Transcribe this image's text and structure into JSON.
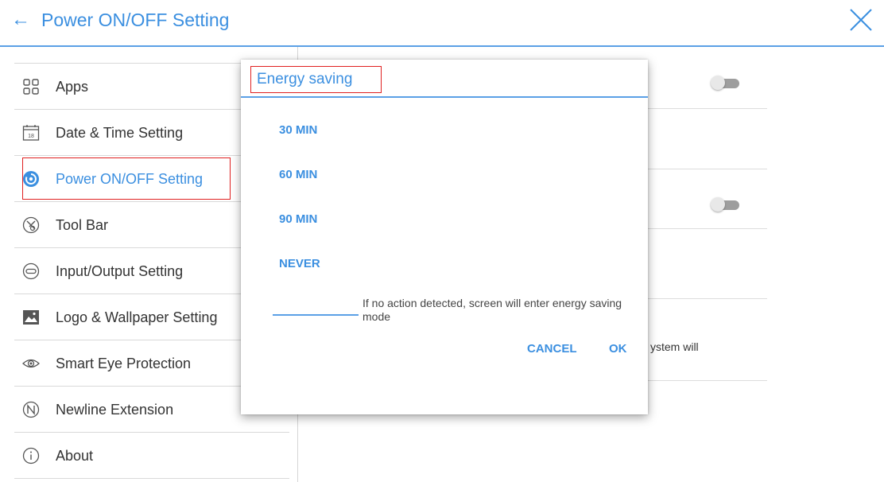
{
  "header": {
    "back_glyph": "←",
    "title": "Power ON/OFF Setting",
    "close_icon": "close-icon"
  },
  "sidebar": {
    "items": [
      {
        "label": "Apps",
        "icon": "apps-grid-icon"
      },
      {
        "label": "Date & Time Setting",
        "icon": "calendar-icon",
        "icon_text": "18"
      },
      {
        "label": "Power ON/OFF Setting",
        "icon": "power-icon",
        "active": true
      },
      {
        "label": "Tool Bar",
        "icon": "tools-icon"
      },
      {
        "label": "Input/Output Setting",
        "icon": "input-output-icon"
      },
      {
        "label": "Logo & Wallpaper Setting",
        "icon": "image-icon"
      },
      {
        "label": "Smart Eye Protection",
        "icon": "eye-icon"
      },
      {
        "label": "Newline Extension",
        "icon": "newline-icon"
      },
      {
        "label": "About",
        "icon": "info-icon"
      }
    ]
  },
  "content": {
    "partial_text": "ystem will"
  },
  "dialog": {
    "title": "Energy saving",
    "options": [
      "30 MIN",
      "60 MIN",
      "90 MIN",
      "NEVER"
    ],
    "description": "If no action detected, screen will enter energy saving mode",
    "cancel_label": "CANCEL",
    "ok_label": "OK"
  },
  "colors": {
    "accent": "#3b8fe0",
    "highlight_box": "#e02020",
    "toggle_track": "#9e9e9e"
  }
}
